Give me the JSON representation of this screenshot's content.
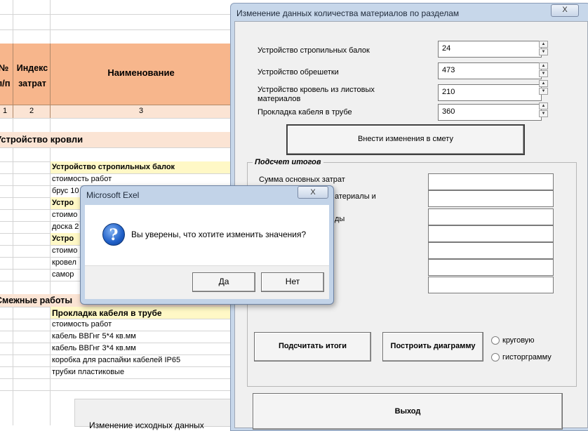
{
  "sheet": {
    "header": {
      "col_a": "№\nп/п",
      "col_b": "Индекс затрат",
      "col_c": "Наименование"
    },
    "header_numbers": [
      "1",
      "2",
      "3"
    ],
    "section1": "Устройство кровли",
    "section2": "Смежные работы",
    "rows": [
      {
        "text": "Устройство стропильных балок",
        "style": "yellow"
      },
      {
        "text": "стоимость работ",
        "style": "plain"
      },
      {
        "text": "брус 10",
        "style": "plain"
      },
      {
        "text": "Устро",
        "style": "yellow"
      },
      {
        "text": "стоимо",
        "style": "plain"
      },
      {
        "text": "доска 2",
        "style": "plain"
      },
      {
        "text": "Устро",
        "style": "yellow"
      },
      {
        "text": "стоимо",
        "style": "plain"
      },
      {
        "text": "кровел",
        "style": "plain"
      },
      {
        "text": "самор",
        "style": "plain"
      }
    ],
    "rows2": [
      {
        "text": "Прокладка кабеля в трубе",
        "style": "yellow"
      },
      {
        "text": "стоимость работ",
        "style": "plain"
      },
      {
        "text": "кабель ВВГнг 5*4 кв.мм",
        "style": "plain"
      },
      {
        "text": "кабель ВВГнг 3*4 кв.мм",
        "style": "plain"
      },
      {
        "text": "коробка для распайки кабелей IP65",
        "style": "plain"
      },
      {
        "text": "трубки пластиковые",
        "style": "plain"
      }
    ],
    "bottom_button": "Изменение исходных данных"
  },
  "form": {
    "title": "Изменение данных количества материалов по разделам",
    "close": "X",
    "fields": [
      {
        "label": "Устройство стропильных балок",
        "value": "24"
      },
      {
        "label": "Устройство обрешетки",
        "value": "473"
      },
      {
        "label": "Устройство кровель из листовых материалов",
        "value": "210"
      },
      {
        "label": "Прокладка кабеля в трубе",
        "value": "360"
      }
    ],
    "apply_button": "Внести изменения в смету",
    "totals_group": "Подсчет итогов",
    "totals_labels": [
      "Сумма основных затрат",
      "атериалы и",
      "ды"
    ],
    "calc_button": "Подсчитать итоги",
    "chart_button": "Построить диаграмму",
    "radio_pie": "круговую",
    "radio_hist": "гисторграмму",
    "exit_button": "Выход"
  },
  "dialog": {
    "title": "Microsoft Exel",
    "close": "X",
    "message": "Вы уверены, что хотите изменить значения?",
    "yes": "Да",
    "no": "Нет"
  }
}
